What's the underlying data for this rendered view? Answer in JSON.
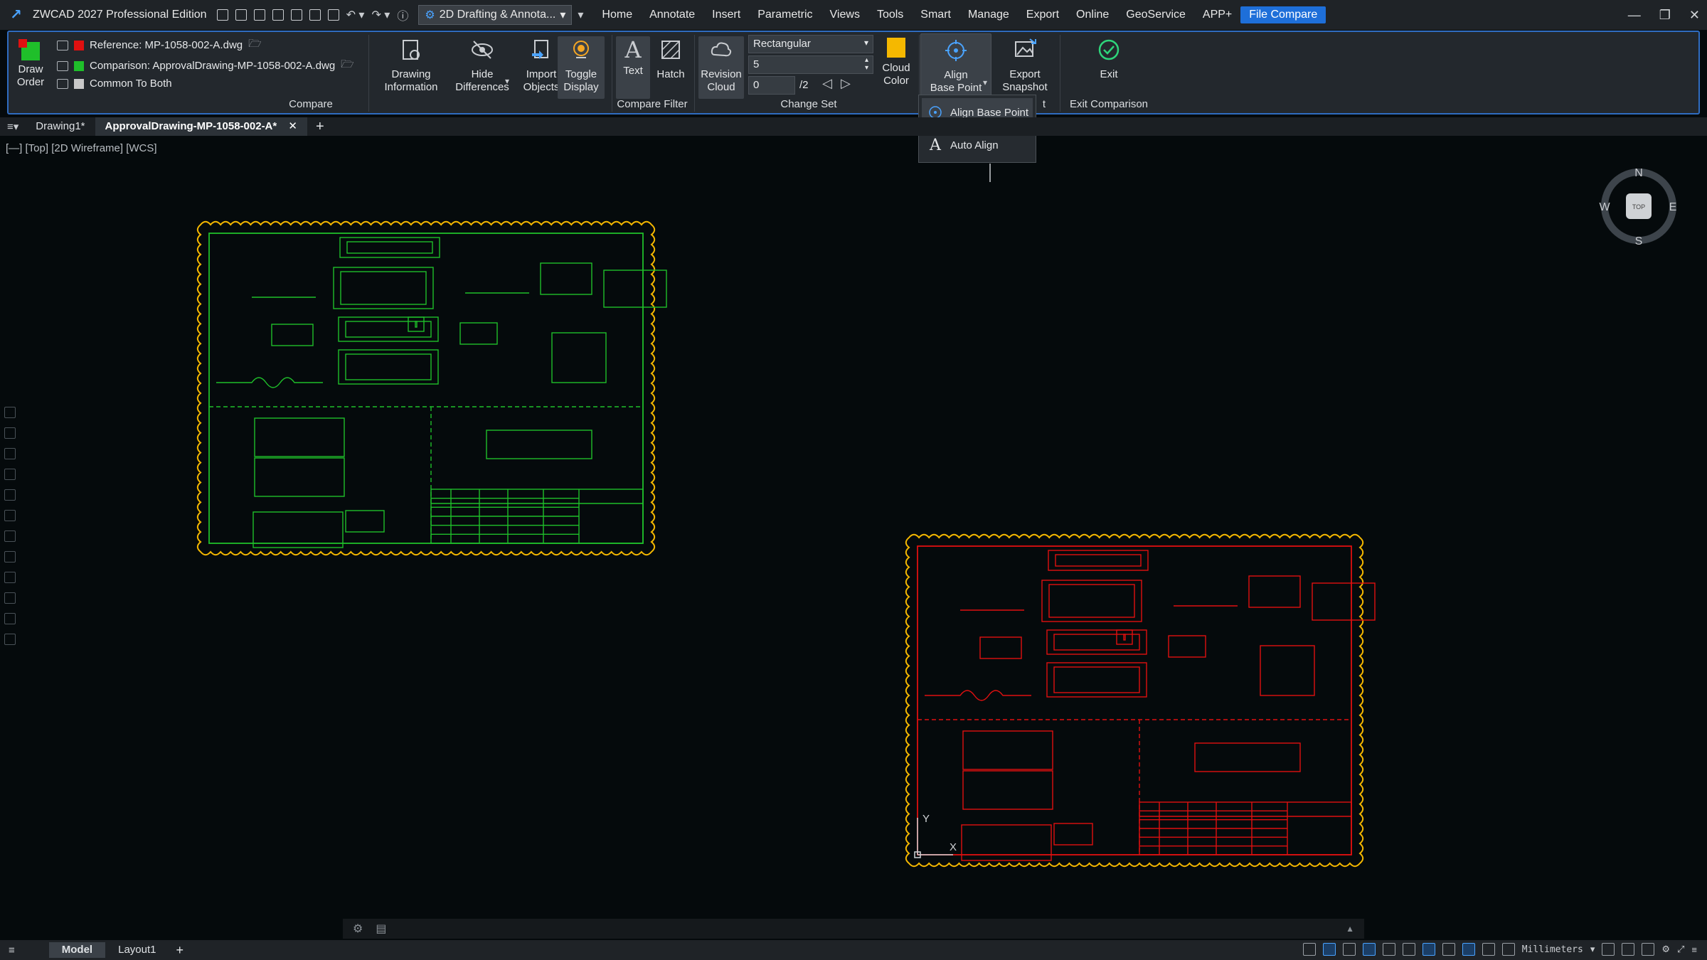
{
  "app": {
    "title": "ZWCAD 2027 Professional Edition",
    "workspace": "2D Drafting & Annota...",
    "menu": [
      "Home",
      "Annotate",
      "Insert",
      "Parametric",
      "Views",
      "Tools",
      "Smart",
      "Manage",
      "Export",
      "Online",
      "GeoService",
      "APP+",
      "File Compare"
    ],
    "active_menu": "File Compare"
  },
  "ribbon": {
    "draw_order": "Draw\nOrder",
    "reference_label": "Reference: MP-1058-002-A.dwg",
    "comparison_label": "Comparison: ApprovalDrawing-MP-1058-002-A.dwg",
    "common_label": "Common To Both",
    "compare_group": "Compare",
    "drawing_information": "Drawing\nInformation",
    "hide_differences": "Hide\nDifferences",
    "import_objects": "Import\nObjects",
    "toggle_display": "Toggle\nDisplay",
    "text_btn": "Text",
    "hatch_btn": "Hatch",
    "compare_filter_group": "Compare Filter",
    "revision_cloud": "Revision\nCloud",
    "shape_select": "Rectangular",
    "size_value": "5",
    "set_index": "0",
    "set_total": "/2",
    "cloud_color": "Cloud\nColor",
    "change_set_group": "Change Set",
    "align_base_point": "Align\nBase Point",
    "export_snapshot": "Export\nSnapshot",
    "exit_btn": "Exit",
    "exit_group": "Exit Comparison",
    "export_group_partial": "t"
  },
  "colors": {
    "reference": "#e01010",
    "comparison": "#1fbf2a",
    "common": "#c8c8c8",
    "cloud_color": "#f5b800",
    "accent": "#1e6fd9"
  },
  "dropdown": {
    "items": [
      "Align Base Point",
      "Auto Align"
    ]
  },
  "tabs": {
    "items": [
      "Drawing1*",
      "ApprovalDrawing-MP-1058-002-A*"
    ],
    "active": "ApprovalDrawing-MP-1058-002-A*"
  },
  "viewport": {
    "label": "[—] [Top] [2D Wireframe] [WCS]",
    "compass": {
      "n": "N",
      "s": "S",
      "e": "E",
      "w": "W",
      "face": "TOP"
    },
    "ucs": {
      "x": "X",
      "y": "Y"
    }
  },
  "status": {
    "tabs": [
      "Model",
      "Layout1"
    ],
    "active_tab": "Model",
    "units": "Millimeters"
  }
}
